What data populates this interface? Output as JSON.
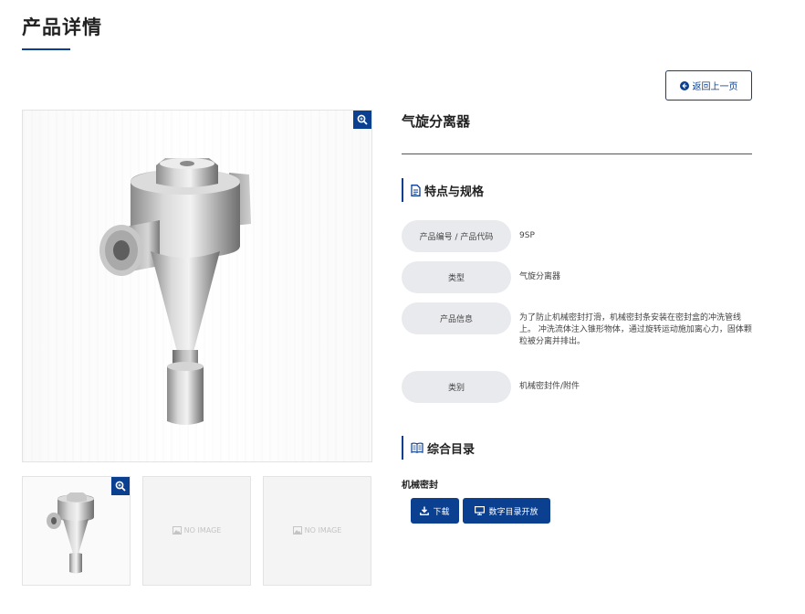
{
  "page": {
    "title": "产品详情"
  },
  "actions": {
    "back_label": "返回上一页"
  },
  "product": {
    "name": "气旋分离器",
    "image_alt": "气旋分离器",
    "thumbnails": [
      {
        "label": ""
      },
      {
        "label": "NO IMAGE"
      },
      {
        "label": "NO IMAGE"
      }
    ]
  },
  "specs": {
    "heading": "特点与规格",
    "rows": [
      {
        "label": "产品编号 / 产品代码",
        "value": "9SP"
      },
      {
        "label": "类型",
        "value": "气旋分离器"
      },
      {
        "label": "产品信息",
        "value": "为了防止机械密封打滑，机械密封条安装在密封盒的冲洗管线上。 冲洗流体注入锥形物体，通过旋转运动施加离心力，固体颗粒被分离并排出。"
      },
      {
        "label": "类别",
        "value": "机械密封件/附件"
      }
    ]
  },
  "catalog": {
    "heading": "综合目录",
    "name": "机械密封",
    "download_label": "下载",
    "digital_label": "数字目录开放"
  },
  "colors": {
    "accent": "#0b3f8f",
    "pill": "#e8eaed"
  },
  "icons": [
    "arrow-left-circle-icon",
    "zoom-in-icon",
    "document-icon",
    "book-icon",
    "download-icon",
    "monitor-icon",
    "image-placeholder-icon"
  ]
}
